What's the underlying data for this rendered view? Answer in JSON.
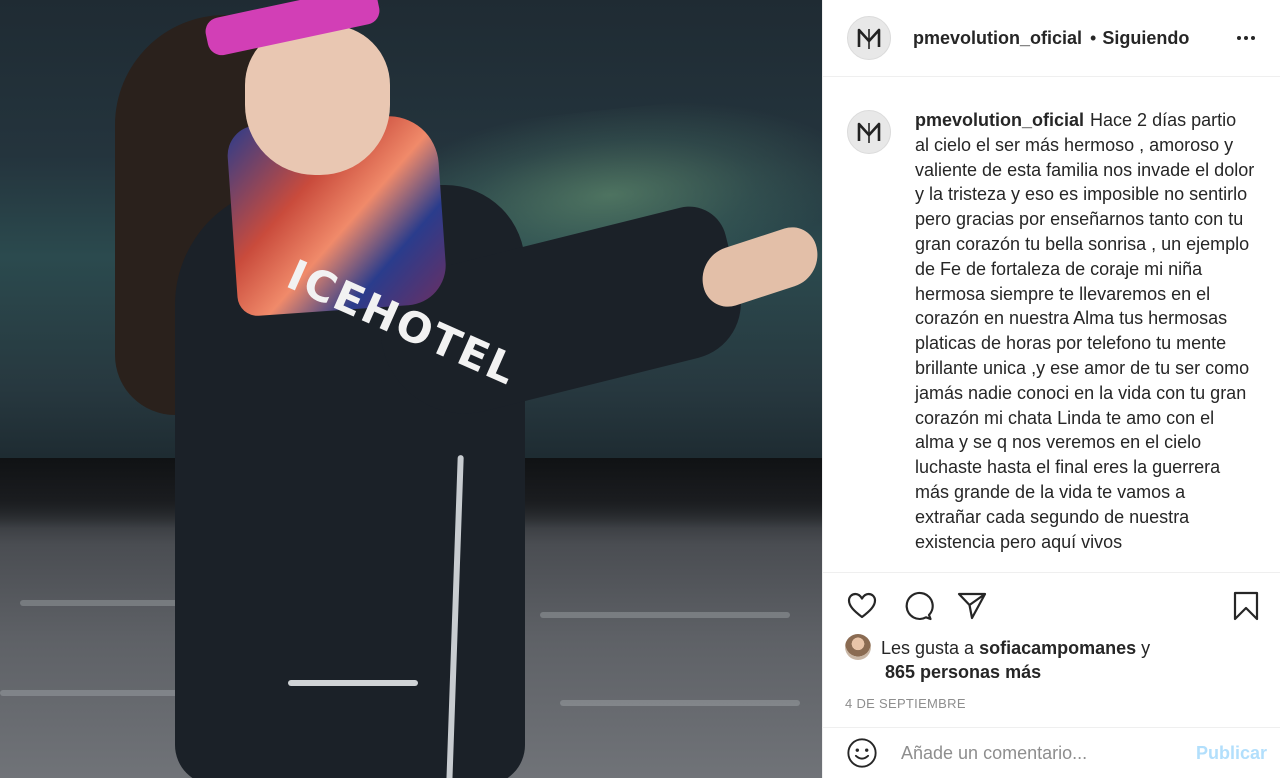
{
  "post": {
    "username": "pmevolution_oficial",
    "separator": "•",
    "follow_status": "Siguiendo",
    "more_icon": "more-horizontal-icon"
  },
  "photo": {
    "jacket_print": "ICEHOTEL"
  },
  "caption": {
    "username": "pmevolution_oficial",
    "text": "Hace 2 días partio al cielo el ser más hermoso , amoroso y valiente de esta familia nos invade el dolor y la tristeza y eso es imposible no sentirlo pero gracias por enseñarnos tanto con tu gran corazón tu bella sonrisa , un ejemplo de Fe de fortaleza de coraje mi niña hermosa siempre te llevaremos en el corazón en nuestra Alma tus hermosas platicas de horas por telefono tu mente brillante unica ,y ese amor de tu ser como jamás nadie conoci en la vida con tu gran corazón mi chata Linda te amo con el alma y se q nos veremos en el cielo luchaste hasta el final eres la guerrera más grande de la vida te vamos a extrañar cada segundo de nuestra existencia pero aquí vivos"
  },
  "actions": {
    "like_icon": "heart-icon",
    "comment_icon": "comment-bubble-icon",
    "share_icon": "paper-plane-icon",
    "save_icon": "bookmark-icon"
  },
  "likes": {
    "prefix": "Les gusta a",
    "liker": "sofiacampomanes",
    "conjunction": "y",
    "others": "865 personas más"
  },
  "date": "4 DE SEPTIEMBRE",
  "comment": {
    "placeholder": "Añade un comentario...",
    "publish_label": "Publicar",
    "emoji_icon": "smiley-icon"
  }
}
